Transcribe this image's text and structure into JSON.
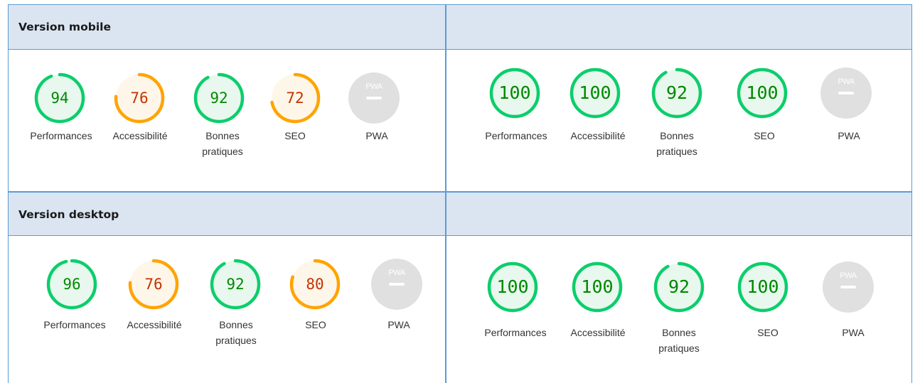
{
  "sections": [
    {
      "title": "Version mobile",
      "left": [
        {
          "label": "Performances",
          "score": "94",
          "value": 94,
          "status": "pass"
        },
        {
          "label": "Accessibilité",
          "score": "76",
          "value": 76,
          "status": "average"
        },
        {
          "label": "Bonnes pratiques",
          "score": "92",
          "value": 92,
          "status": "pass"
        },
        {
          "label": "SEO",
          "score": "72",
          "value": 72,
          "status": "average"
        },
        {
          "label": "PWA",
          "score": "",
          "value": null,
          "status": "na"
        }
      ],
      "right": [
        {
          "label": "Performances",
          "score": "100",
          "value": 100,
          "status": "pass"
        },
        {
          "label": "Accessibilité",
          "score": "100",
          "value": 100,
          "status": "pass"
        },
        {
          "label": "Bonnes pratiques",
          "score": "92",
          "value": 92,
          "status": "pass"
        },
        {
          "label": "SEO",
          "score": "100",
          "value": 100,
          "status": "pass"
        },
        {
          "label": "PWA",
          "score": "",
          "value": null,
          "status": "na"
        }
      ]
    },
    {
      "title": "Version desktop",
      "left": [
        {
          "label": "Performances",
          "score": "96",
          "value": 96,
          "status": "pass"
        },
        {
          "label": "Accessibilité",
          "score": "76",
          "value": 76,
          "status": "average"
        },
        {
          "label": "Bonnes pratiques",
          "score": "92",
          "value": 92,
          "status": "pass"
        },
        {
          "label": "SEO",
          "score": "80",
          "value": 80,
          "status": "average"
        },
        {
          "label": "PWA",
          "score": "",
          "value": null,
          "status": "na"
        }
      ],
      "right": [
        {
          "label": "Performances",
          "score": "100",
          "value": 100,
          "status": "pass"
        },
        {
          "label": "Accessibilité",
          "score": "100",
          "value": 100,
          "status": "pass"
        },
        {
          "label": "Bonnes pratiques",
          "score": "92",
          "value": 92,
          "status": "pass"
        },
        {
          "label": "SEO",
          "score": "100",
          "value": 100,
          "status": "pass"
        },
        {
          "label": "PWA",
          "score": "",
          "value": null,
          "status": "na"
        }
      ]
    }
  ],
  "pwa_badge": "PWA",
  "colors": {
    "pass": {
      "ring": "#0cce6b",
      "fill": "#e8f8ee",
      "text": "#008800"
    },
    "average": {
      "ring": "#ffa400",
      "fill": "#fff6ea",
      "text": "#c33300"
    },
    "na": {
      "fill": "#e0e0e0"
    },
    "header_bg": "#dbe5f1",
    "border": "#5b9bd5"
  }
}
